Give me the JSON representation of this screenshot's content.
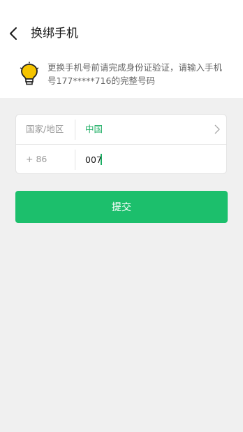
{
  "header": {
    "title": "换绑手机",
    "back_icon": "chevron-left-icon"
  },
  "notice": {
    "icon": "lightbulb-icon",
    "text": "更换手机号前请完成身份证验证，请输入手机号177*****716的完整号码"
  },
  "form": {
    "region_label": "国家/地区",
    "region_value": "中国",
    "country_code": "+ 86",
    "phone_value": "007"
  },
  "submit_label": "提交",
  "colors": {
    "accent": "#1aad62",
    "button": "#1cbf6c",
    "background": "#f0f0f0"
  }
}
